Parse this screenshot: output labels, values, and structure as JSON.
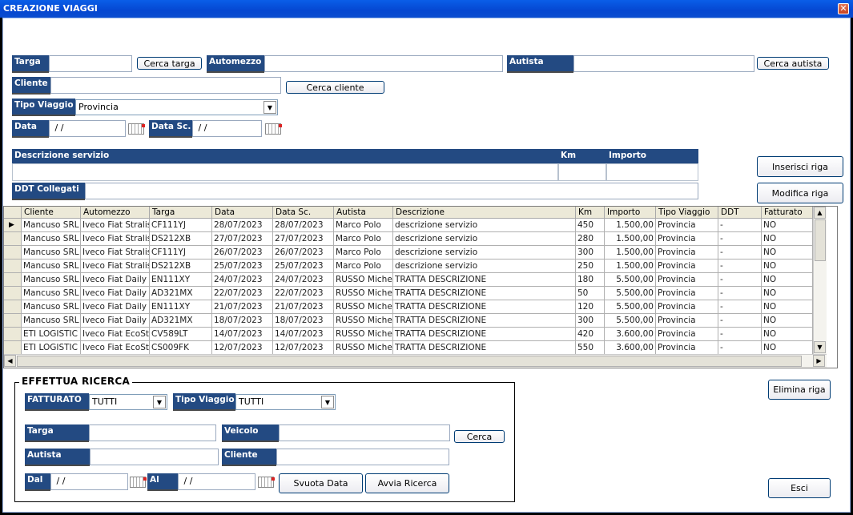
{
  "window": {
    "title": "CREAZIONE VIAGGI",
    "close_icon": "close-icon"
  },
  "form": {
    "targa_label": "Targa",
    "targa_value": "",
    "cerca_targa": "Cerca targa",
    "automezzo_label": "Automezzo",
    "automezzo_value": "",
    "autista_label": "Autista",
    "autista_value": "",
    "cerca_autista": "Cerca autista",
    "cliente_label": "Cliente",
    "cliente_value": "",
    "cerca_cliente": "Cerca cliente",
    "tipo_viaggio_label": "Tipo Viaggio",
    "tipo_viaggio_value": "Provincia",
    "data_label": "Data",
    "data_value": " / /",
    "data_sc_label": "Data Sc.",
    "data_sc_value": " / /"
  },
  "service": {
    "descrizione_label": "Descrizione servizio",
    "km_label": "Km",
    "importo_label": "Importo",
    "ddt_label": "DDT Collegati"
  },
  "actions": {
    "inserisci": "Inserisci riga",
    "modifica": "Modifica riga",
    "elimina": "Elimina riga",
    "esci": "Esci"
  },
  "table": {
    "columns": [
      "Cliente",
      "Automezzo",
      "Targa",
      "Data",
      "Data Sc.",
      "Autista",
      "Descrizione",
      "Km",
      "Importo",
      "Tipo Viaggio",
      "DDT",
      "Fatturato"
    ],
    "rows": [
      [
        "Mancuso SRL",
        "Iveco Fiat Stralis",
        "CF111YJ",
        "28/07/2023",
        "28/07/2023",
        "Marco Polo",
        "descrizione servizio",
        "450",
        "1.500,00",
        "Provincia",
        "-",
        "NO"
      ],
      [
        "Mancuso SRL",
        "Iveco Fiat Stralis",
        "DS212XB",
        "27/07/2023",
        "27/07/2023",
        "Marco Polo",
        "descrizione servizio",
        "280",
        "1.500,00",
        "Provincia",
        "-",
        "NO"
      ],
      [
        "Mancuso SRL",
        "Iveco Fiat Stralis",
        "CF111YJ",
        "26/07/2023",
        "26/07/2023",
        "Marco Polo",
        "descrizione servizio",
        "300",
        "1.500,00",
        "Provincia",
        "-",
        "NO"
      ],
      [
        "Mancuso SRL",
        "Iveco Fiat Stralis",
        "DS212XB",
        "25/07/2023",
        "25/07/2023",
        "Marco Polo",
        "descrizione servizio",
        "250",
        "1.500,00",
        "Provincia",
        "-",
        "NO"
      ],
      [
        "Mancuso SRL",
        "Iveco Fiat Daily S",
        "EN111XY",
        "24/07/2023",
        "24/07/2023",
        "RUSSO Miche",
        "TRATTA DESCRIZIONE",
        "180",
        "5.500,00",
        "Provincia",
        "-",
        "NO"
      ],
      [
        "Mancuso SRL",
        "Iveco Fiat Daily S",
        "AD321MX",
        "22/07/2023",
        "22/07/2023",
        "RUSSO Miche",
        "TRATTA DESCRIZIONE",
        "50",
        "5.500,00",
        "Provincia",
        "-",
        "NO"
      ],
      [
        "Mancuso SRL",
        "Iveco Fiat Daily S",
        "EN111XY",
        "21/07/2023",
        "21/07/2023",
        "RUSSO Miche",
        "TRATTA DESCRIZIONE",
        "120",
        "5.500,00",
        "Provincia",
        "-",
        "NO"
      ],
      [
        "Mancuso SRL",
        "Iveco Fiat Daily S",
        "AD321MX",
        "18/07/2023",
        "18/07/2023",
        "RUSSO Miche",
        "TRATTA DESCRIZIONE",
        "300",
        "5.500,00",
        "Provincia",
        "-",
        "NO"
      ],
      [
        "ETI  LOGISTIC",
        "Iveco Fiat EcoSt",
        "CV589LT",
        "14/07/2023",
        "14/07/2023",
        "RUSSO Miche",
        "TRATTA DESCRIZIONE",
        "420",
        "3.600,00",
        "Provincia",
        "-",
        "NO"
      ],
      [
        "ETI  LOGISTIC",
        "Iveco Fiat EcoSt",
        "CS009FK",
        "12/07/2023",
        "12/07/2023",
        "RUSSO Miche",
        "TRATTA DESCRIZIONE",
        "550",
        "3.600,00",
        "Provincia",
        "-",
        "NO"
      ]
    ]
  },
  "search": {
    "group_title": "EFFETTUA RICERCA",
    "fatturato_label": "FATTURATO",
    "fatturato_value": "TUTTI",
    "tipo_viaggio_label": "Tipo Viaggio",
    "tipo_viaggio_value": "TUTTI",
    "targa_label": "Targa",
    "veicolo_label": "Veicolo",
    "cerca": "Cerca",
    "autista_label": "Autista",
    "cliente_label": "Cliente",
    "dal_label": "Dal",
    "dal_value": " / /",
    "al_label": "Al",
    "al_value": " / /",
    "svuota": "Svuota Data",
    "avvia": "Avvia Ricerca"
  }
}
